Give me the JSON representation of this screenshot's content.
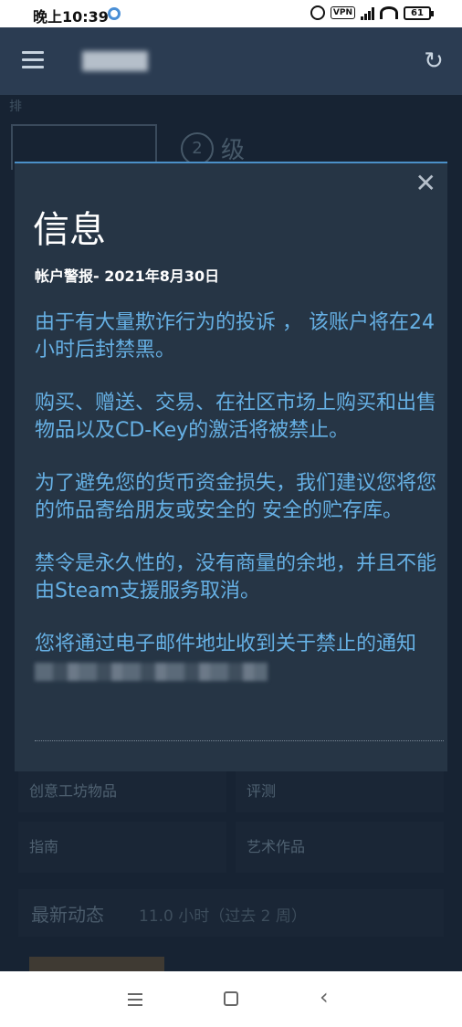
{
  "status_bar": {
    "time": "晚上10:39",
    "vpn": "VPN",
    "battery": "61"
  },
  "header": {
    "menu_icon": "hamburger-icon",
    "refresh_icon": "refresh-icon"
  },
  "background": {
    "tab_fragment": "排",
    "level_number": "2",
    "level_label": "级",
    "tiles": [
      "创意工坊物品",
      "评测",
      "指南",
      "艺术作品"
    ],
    "recent_activity_title": "最新动态",
    "recent_activity_sub": "11.0 小时（过去 2 周）"
  },
  "modal": {
    "title": "信息",
    "subtitle": "帐户警报- 2021年8月30日",
    "paragraphs": [
      "由于有大量欺诈行为的投诉 ， 该账户将在24小时后封禁黑。",
      "购买、赠送、交易、在社区市场上购买和出售物品以及CD-Key的激活将被禁止。",
      "为了避免您的货币资金损失，我们建议您将您的饰品寄给朋友或安全的 安全的贮存库。",
      "禁令是永久性的，没有商量的余地，并且不能由Steam支援服务取消。",
      "您将通过电子邮件地址收到关于禁止的通知"
    ],
    "close_symbol": "✕"
  },
  "colors": {
    "header_bg": "#2b3c52",
    "modal_bg": "#263545",
    "modal_accent": "#4b90c8",
    "body_text": "#66b0e4"
  }
}
